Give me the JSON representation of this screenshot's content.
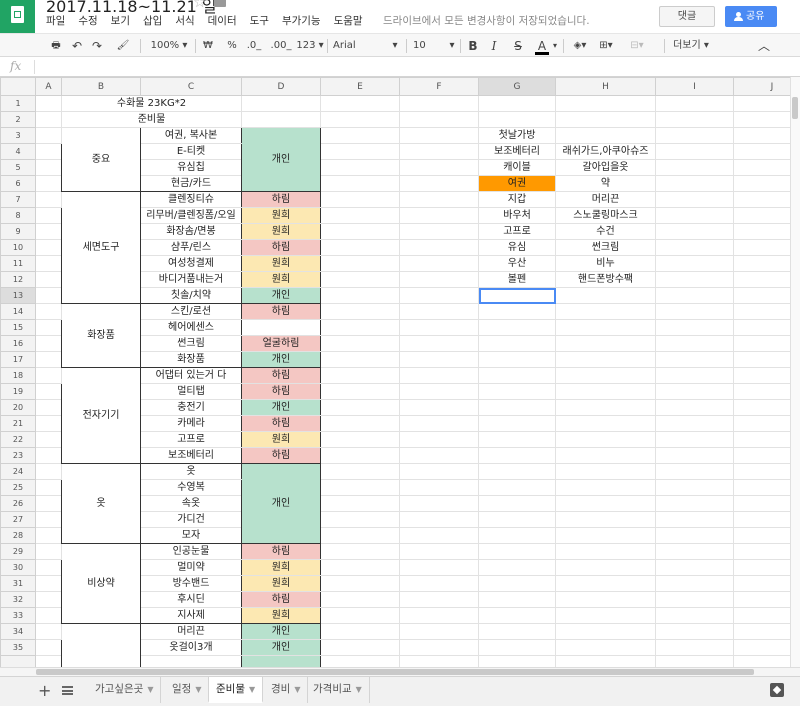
{
  "document": {
    "title": "2017.11.18~11.21 일"
  },
  "menu": [
    "파일",
    "수정",
    "보기",
    "삽입",
    "서식",
    "데이터",
    "도구",
    "부가기능",
    "도움말"
  ],
  "save_status": "드라이브에서 모든 변경사항이 저장되었습니다.",
  "buttons": {
    "comment": "댓글",
    "share": "공유"
  },
  "toolbar": {
    "zoom": "100% ▾",
    "currency": "₩",
    "percent": "%",
    "dec_less": ".0_",
    "dec_more": ".00_",
    "format_more": "123 ▾",
    "font": "Arial",
    "font_arrow": "▾",
    "size": "10",
    "size_arrow": "▾",
    "bold": "B",
    "italic": "I",
    "strike": "S",
    "textcolor": "A",
    "more": "더보기 ▾"
  },
  "formula_bar": {
    "fx": "fx",
    "value": ""
  },
  "columns": [
    "",
    "A",
    "B",
    "C",
    "D",
    "E",
    "F",
    "G",
    "H",
    "I",
    "J"
  ],
  "selected_column": "G",
  "selected_row": "13",
  "rows": {
    "1": {
      "merged_bc": "수화물 23KG*2"
    },
    "2": {
      "merged_bc": "준비물"
    },
    "3": {
      "C": "여권, 복사본",
      "G": "첫날가방"
    },
    "4": {
      "B": "중요",
      "C": "E-티켓",
      "D": "개인",
      "G": "보조베터리",
      "H": "래쉬가드,아쿠아슈즈"
    },
    "5": {
      "C": "유심칩",
      "G": "캐이블",
      "H": "갈아입을옷"
    },
    "6": {
      "C": "현금/카드",
      "G": "여권",
      "H": "약"
    },
    "7": {
      "C": "클렌징티슈",
      "D": "하림",
      "G": "지갑",
      "H": "머리끈"
    },
    "8": {
      "C": "리무버/클렌징폼/오일",
      "D": "원희",
      "G": "바우처",
      "H": "스노쿨링마스크"
    },
    "9": {
      "C": "화장솜/면봉",
      "D": "원희",
      "G": "고프로",
      "H": "수건"
    },
    "10": {
      "B": "세면도구",
      "C": "샴푸/린스",
      "D": "하림",
      "G": "유심",
      "H": "썬크림"
    },
    "11": {
      "C": "여성청결제",
      "D": "원희",
      "G": "우산",
      "H": "비누"
    },
    "12": {
      "C": "바디거품내는거",
      "D": "원희",
      "G": "볼펜",
      "H": "핸드폰방수팩"
    },
    "13": {
      "C": "칫솔/치약",
      "D": "개인"
    },
    "14": {
      "C": "스킨/로션",
      "D": "하림"
    },
    "15": {
      "B": "화장품",
      "C": "헤어에센스",
      "D": ""
    },
    "16": {
      "C": "썬크림",
      "D": "얼굴하림"
    },
    "17": {
      "C": "화장품",
      "D": "개인"
    },
    "18": {
      "C": "어댑터 있는거 다",
      "D": "하림"
    },
    "19": {
      "C": "멀티탭",
      "D": "하림"
    },
    "20": {
      "B": "전자기기",
      "C": "충전기",
      "D": "개인"
    },
    "21": {
      "C": "카메라",
      "D": "하림"
    },
    "22": {
      "C": "고프로",
      "D": "원희"
    },
    "23": {
      "C": "보조베터리",
      "D": "하림"
    },
    "24": {
      "C": "옷"
    },
    "25": {
      "C": "수영복"
    },
    "26": {
      "B": "옷",
      "C": "속옷",
      "D": "개인"
    },
    "27": {
      "C": "가디건"
    },
    "28": {
      "C": "모자"
    },
    "29": {
      "C": "인공눈물",
      "D": "하림"
    },
    "30": {
      "C": "멀미약",
      "D": "원희"
    },
    "31": {
      "B": "비상약",
      "C": "방수밴드",
      "D": "원희"
    },
    "32": {
      "C": "후시딘",
      "D": "하림"
    },
    "33": {
      "C": "지사제",
      "D": "원희"
    },
    "34": {
      "C": "머리끈",
      "D": "개인"
    },
    "35": {
      "C": "옷걸이3개",
      "D": "개인"
    }
  },
  "colors": {
    "pink": "#f4c7c3",
    "yellow": "#fce8b2",
    "green": "#b7e1cd",
    "orange": "#ff9900",
    "accent": "#4a8af4"
  },
  "sheets": [
    {
      "label": "가고싶은곳"
    },
    {
      "label": "일정"
    },
    {
      "label": "준비물",
      "active": true
    },
    {
      "label": "경비"
    },
    {
      "label": "가격비교"
    }
  ]
}
